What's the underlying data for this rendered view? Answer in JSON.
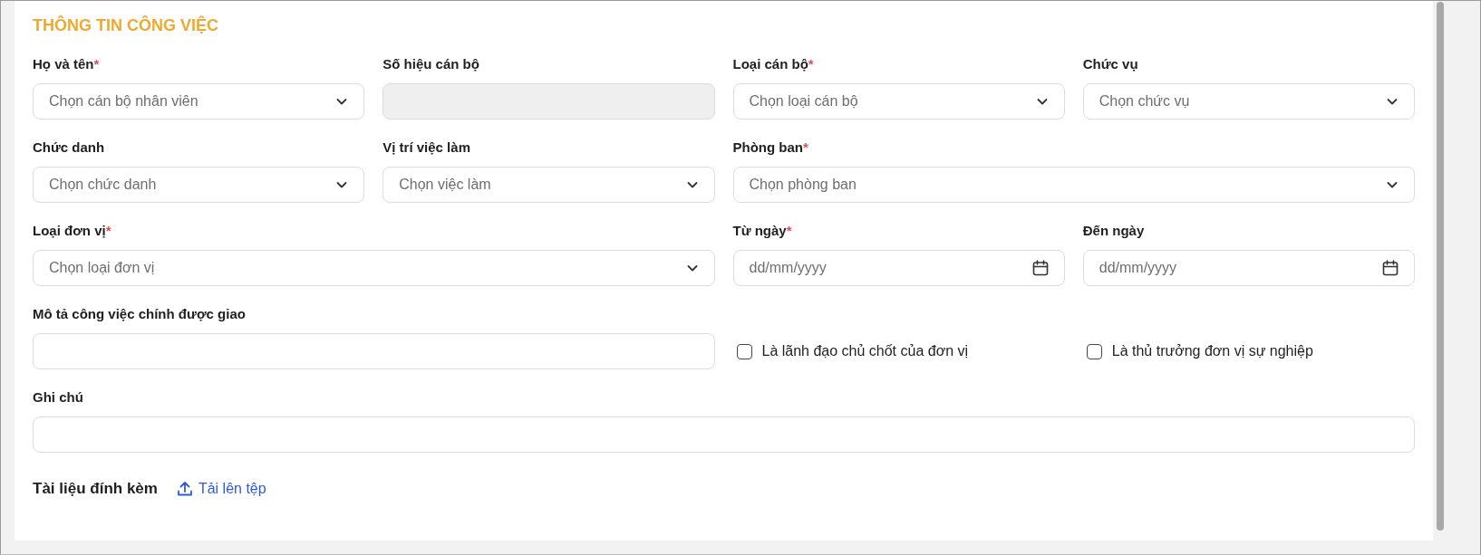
{
  "section_title": "THÔNG TIN CÔNG VIỆC",
  "rows": [
    [
      {
        "kind": "select",
        "label": "Họ và tên",
        "mark": "*",
        "placeholder": "Chọn cán bộ nhân viên"
      },
      {
        "kind": "readonly",
        "label": "Số hiệu cán bộ",
        "disabled": true
      },
      {
        "kind": "select",
        "label": "Loại cán bộ",
        "mark": "*",
        "placeholder": "Chọn loại cán bộ"
      },
      {
        "kind": "select",
        "label": "Chức vụ",
        "placeholder": "Chọn chức vụ"
      }
    ],
    [
      {
        "kind": "select",
        "label": "Chức danh",
        "placeholder": "Chọn chức danh"
      },
      {
        "kind": "select",
        "label": "Vị trí việc làm",
        "placeholder": "Chọn việc làm"
      },
      {
        "kind": "select",
        "label": "Phòng ban",
        "mark": "*",
        "placeholder": "Chọn phòng ban"
      }
    ],
    [
      {
        "kind": "select",
        "label": "Loại đơn vị",
        "mark": "*",
        "placeholder": "Chọn loại đơn vị"
      },
      {
        "kind": "date",
        "label": "Từ ngày",
        "mark": "*",
        "placeholder": "dd/mm/yyyy"
      },
      {
        "kind": "date",
        "label": "Đến ngày",
        "placeholder": "dd/mm/yyyy"
      }
    ],
    [
      {
        "kind": "text",
        "label": "Mô tả công việc chính được giao"
      },
      {
        "kind": "checkbox",
        "label": "Là lãnh đạo chủ chốt của đơn vị",
        "checked": false
      },
      {
        "kind": "checkbox",
        "label": "Là thủ trưởng đơn vị sự nghiệp",
        "checked": false
      }
    ],
    [
      {
        "kind": "text",
        "label": "Ghi chú"
      }
    ]
  ],
  "attachments": {
    "title": "Tài liệu đính kèm",
    "upload_link": "Tải lên tệp"
  }
}
